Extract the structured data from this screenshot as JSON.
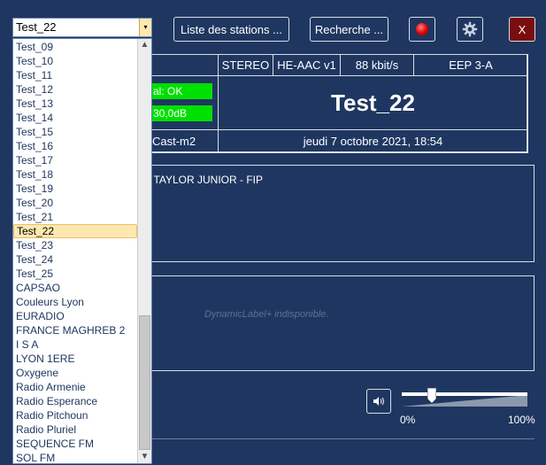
{
  "toolbar": {
    "station_value": "Test_22",
    "stations_list_label": "Liste des stations ...",
    "search_label": "Recherche ...",
    "close_label": "X"
  },
  "info": {
    "stereo": "STEREO",
    "codec": "HE-AAC v1",
    "bitrate": "88 kbit/s",
    "protection": "EEP 3-A",
    "signal": "al: OK",
    "snr": "30,0dB",
    "station_name": "Test_22",
    "program_type": "Cast-m2",
    "datetime": "jeudi 7 octobre 2021, 18:54"
  },
  "radiotext": "O TAYLOR JUNIOR - FIP",
  "dynamic_label": "DynamicLabel+ indisponible.",
  "volume": {
    "min_label": "0%",
    "max_label": "100%",
    "level": 0.22
  },
  "dropdown": {
    "items": [
      "Test_09",
      "Test_10",
      "Test_11",
      "Test_12",
      "Test_13",
      "Test_14",
      "Test_15",
      "Test_16",
      "Test_17",
      "Test_18",
      "Test_19",
      "Test_20",
      "Test_21",
      "Test_22",
      "Test_23",
      "Test_24",
      "Test_25",
      "CAPSAO",
      "Couleurs Lyon",
      "EURADIO",
      "FRANCE MAGHREB 2",
      "I S A",
      "LYON 1ERE",
      "Oxygene",
      "Radio Armenie",
      "Radio Esperance",
      "Radio Pitchoun",
      "Radio Pluriel",
      "SEQUENCE FM",
      "SOL FM"
    ],
    "selected": "Test_22"
  },
  "colors": {
    "background": "#1f3760",
    "signal_ok": "#00e000",
    "record": "#e00000",
    "close_bg": "#7a0d0d"
  }
}
